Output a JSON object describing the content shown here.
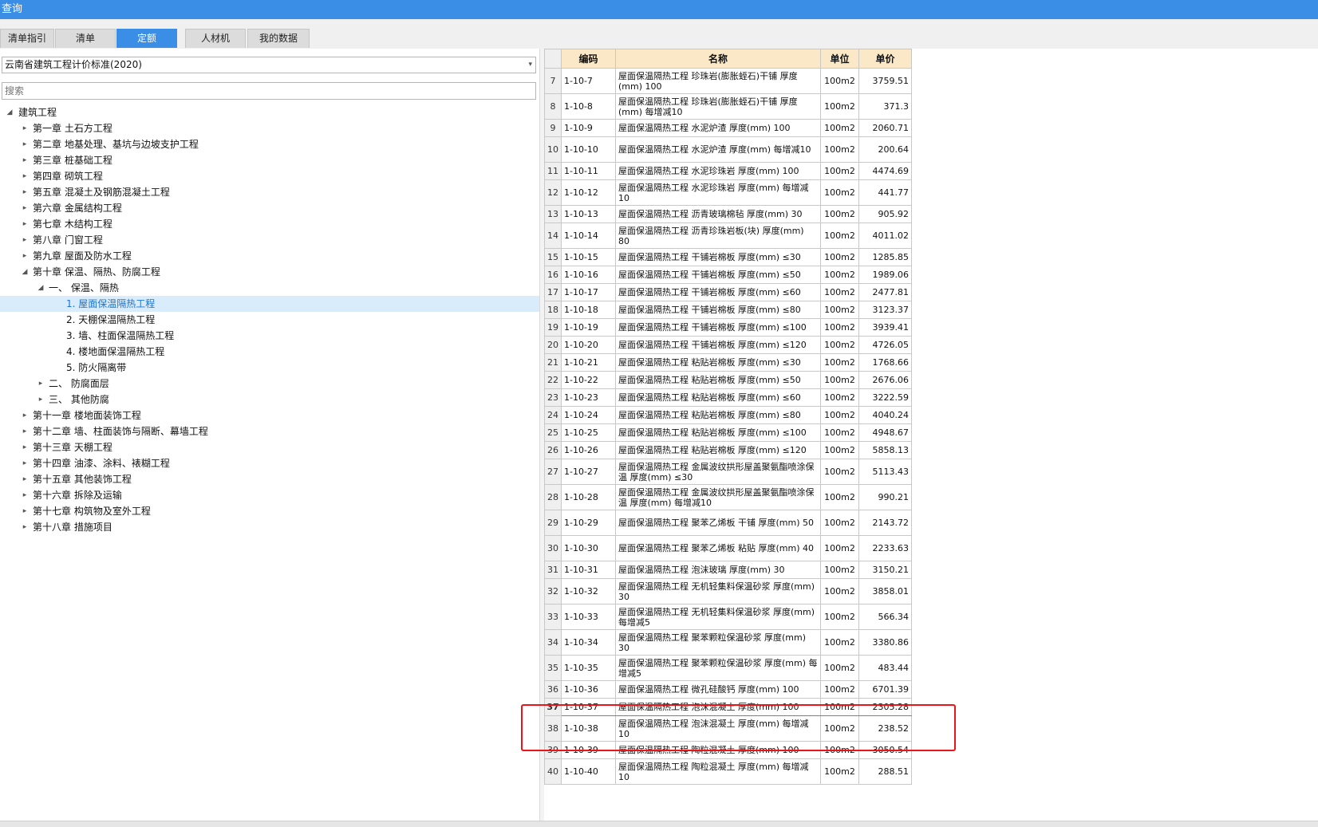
{
  "window": {
    "title": "查询"
  },
  "tabs": [
    {
      "label": "清单指引",
      "active": false
    },
    {
      "label": "清单",
      "active": false
    },
    {
      "label": "定额",
      "active": true
    },
    {
      "label": "人材机",
      "active": false
    },
    {
      "label": "我的数据",
      "active": false
    }
  ],
  "left": {
    "standard_select": {
      "value": "云南省建筑工程计价标准(2020)"
    },
    "search": {
      "placeholder": "搜索"
    },
    "tree": [
      {
        "label": "建筑工程",
        "level": 0,
        "toggle": "expanded"
      },
      {
        "label": "第一章 土石方工程",
        "level": 1,
        "toggle": "collapsed"
      },
      {
        "label": "第二章 地基处理、基坑与边坡支护工程",
        "level": 1,
        "toggle": "collapsed"
      },
      {
        "label": "第三章 桩基础工程",
        "level": 1,
        "toggle": "collapsed"
      },
      {
        "label": "第四章 砌筑工程",
        "level": 1,
        "toggle": "collapsed"
      },
      {
        "label": "第五章 混凝土及钢筋混凝土工程",
        "level": 1,
        "toggle": "collapsed"
      },
      {
        "label": "第六章 金属结构工程",
        "level": 1,
        "toggle": "collapsed"
      },
      {
        "label": "第七章 木结构工程",
        "level": 1,
        "toggle": "collapsed"
      },
      {
        "label": "第八章 门窗工程",
        "level": 1,
        "toggle": "collapsed"
      },
      {
        "label": "第九章 屋面及防水工程",
        "level": 1,
        "toggle": "collapsed"
      },
      {
        "label": "第十章 保温、隔热、防腐工程",
        "level": 1,
        "toggle": "expanded"
      },
      {
        "label": "一、 保温、隔热",
        "level": 2,
        "toggle": "expanded"
      },
      {
        "label": "1. 屋面保温隔热工程",
        "level": 3,
        "toggle": "none",
        "selected": true
      },
      {
        "label": "2. 天棚保温隔热工程",
        "level": 3,
        "toggle": "none"
      },
      {
        "label": "3. 墙、柱面保温隔热工程",
        "level": 3,
        "toggle": "none"
      },
      {
        "label": "4. 楼地面保温隔热工程",
        "level": 3,
        "toggle": "none"
      },
      {
        "label": "5. 防火隔离带",
        "level": 3,
        "toggle": "none"
      },
      {
        "label": "二、 防腐面层",
        "level": 2,
        "toggle": "collapsed"
      },
      {
        "label": "三、 其他防腐",
        "level": 2,
        "toggle": "collapsed"
      },
      {
        "label": "第十一章 楼地面装饰工程",
        "level": 1,
        "toggle": "collapsed"
      },
      {
        "label": "第十二章 墙、柱面装饰与隔断、幕墙工程",
        "level": 1,
        "toggle": "collapsed"
      },
      {
        "label": "第十三章 天棚工程",
        "level": 1,
        "toggle": "collapsed"
      },
      {
        "label": "第十四章 油漆、涂料、裱糊工程",
        "level": 1,
        "toggle": "collapsed"
      },
      {
        "label": "第十五章 其他装饰工程",
        "level": 1,
        "toggle": "collapsed"
      },
      {
        "label": "第十六章 拆除及运输",
        "level": 1,
        "toggle": "collapsed"
      },
      {
        "label": "第十七章 构筑物及室外工程",
        "level": 1,
        "toggle": "collapsed"
      },
      {
        "label": "第十八章 措施项目",
        "level": 1,
        "toggle": "collapsed"
      }
    ]
  },
  "grid": {
    "columns": [
      "编码",
      "名称",
      "单位",
      "单价"
    ],
    "rows": [
      {
        "no": "7",
        "code": "1-10-7",
        "name": "屋面保温隔热工程 珍珠岩(膨胀蛭石)干铺 厚度(mm) 100",
        "unit": "100m2",
        "price": "3759.51",
        "tall": true
      },
      {
        "no": "8",
        "code": "1-10-8",
        "name": "屋面保温隔热工程 珍珠岩(膨胀蛭石)干铺 厚度(mm) 每增减10",
        "unit": "100m2",
        "price": "371.3",
        "tall": true
      },
      {
        "no": "9",
        "code": "1-10-9",
        "name": "屋面保温隔热工程 水泥炉渣 厚度(mm) 100",
        "unit": "100m2",
        "price": "2060.71",
        "tall": false
      },
      {
        "no": "10",
        "code": "1-10-10",
        "name": "屋面保温隔热工程 水泥炉渣 厚度(mm) 每增减10",
        "unit": "100m2",
        "price": "200.64",
        "tall": true
      },
      {
        "no": "11",
        "code": "1-10-11",
        "name": "屋面保温隔热工程 水泥珍珠岩 厚度(mm) 100",
        "unit": "100m2",
        "price": "4474.69",
        "tall": false
      },
      {
        "no": "12",
        "code": "1-10-12",
        "name": "屋面保温隔热工程 水泥珍珠岩 厚度(mm) 每增减10",
        "unit": "100m2",
        "price": "441.77",
        "tall": true
      },
      {
        "no": "13",
        "code": "1-10-13",
        "name": "屋面保温隔热工程 沥青玻璃棉毡 厚度(mm) 30",
        "unit": "100m2",
        "price": "905.92",
        "tall": false
      },
      {
        "no": "14",
        "code": "1-10-14",
        "name": "屋面保温隔热工程 沥青珍珠岩板(块) 厚度(mm) 80",
        "unit": "100m2",
        "price": "4011.02",
        "tall": true
      },
      {
        "no": "15",
        "code": "1-10-15",
        "name": "屋面保温隔热工程 干铺岩棉板 厚度(mm) ≤30",
        "unit": "100m2",
        "price": "1285.85",
        "tall": false
      },
      {
        "no": "16",
        "code": "1-10-16",
        "name": "屋面保温隔热工程 干铺岩棉板 厚度(mm) ≤50",
        "unit": "100m2",
        "price": "1989.06",
        "tall": false
      },
      {
        "no": "17",
        "code": "1-10-17",
        "name": "屋面保温隔热工程 干铺岩棉板 厚度(mm) ≤60",
        "unit": "100m2",
        "price": "2477.81",
        "tall": false
      },
      {
        "no": "18",
        "code": "1-10-18",
        "name": "屋面保温隔热工程 干铺岩棉板 厚度(mm) ≤80",
        "unit": "100m2",
        "price": "3123.37",
        "tall": false
      },
      {
        "no": "19",
        "code": "1-10-19",
        "name": "屋面保温隔热工程 干铺岩棉板 厚度(mm) ≤100",
        "unit": "100m2",
        "price": "3939.41",
        "tall": false
      },
      {
        "no": "20",
        "code": "1-10-20",
        "name": "屋面保温隔热工程 干铺岩棉板 厚度(mm) ≤120",
        "unit": "100m2",
        "price": "4726.05",
        "tall": false
      },
      {
        "no": "21",
        "code": "1-10-21",
        "name": "屋面保温隔热工程 粘贴岩棉板 厚度(mm) ≤30",
        "unit": "100m2",
        "price": "1768.66",
        "tall": false
      },
      {
        "no": "22",
        "code": "1-10-22",
        "name": "屋面保温隔热工程 粘贴岩棉板 厚度(mm) ≤50",
        "unit": "100m2",
        "price": "2676.06",
        "tall": false
      },
      {
        "no": "23",
        "code": "1-10-23",
        "name": "屋面保温隔热工程 粘贴岩棉板 厚度(mm) ≤60",
        "unit": "100m2",
        "price": "3222.59",
        "tall": false
      },
      {
        "no": "24",
        "code": "1-10-24",
        "name": "屋面保温隔热工程 粘贴岩棉板 厚度(mm) ≤80",
        "unit": "100m2",
        "price": "4040.24",
        "tall": false
      },
      {
        "no": "25",
        "code": "1-10-25",
        "name": "屋面保温隔热工程 粘贴岩棉板 厚度(mm) ≤100",
        "unit": "100m2",
        "price": "4948.67",
        "tall": false
      },
      {
        "no": "26",
        "code": "1-10-26",
        "name": "屋面保温隔热工程 粘贴岩棉板 厚度(mm) ≤120",
        "unit": "100m2",
        "price": "5858.13",
        "tall": false
      },
      {
        "no": "27",
        "code": "1-10-27",
        "name": "屋面保温隔热工程 金属波纹拱形屋盖聚氨酯喷涂保温 厚度(mm) ≤30",
        "unit": "100m2",
        "price": "5113.43",
        "tall": true
      },
      {
        "no": "28",
        "code": "1-10-28",
        "name": "屋面保温隔热工程 金属波纹拱形屋盖聚氨酯喷涂保温 厚度(mm) 每增减10",
        "unit": "100m2",
        "price": "990.21",
        "tall": true
      },
      {
        "no": "29",
        "code": "1-10-29",
        "name": "屋面保温隔热工程 聚苯乙烯板 干铺 厚度(mm) 50",
        "unit": "100m2",
        "price": "2143.72",
        "tall": true
      },
      {
        "no": "30",
        "code": "1-10-30",
        "name": "屋面保温隔热工程 聚苯乙烯板 粘贴 厚度(mm) 40",
        "unit": "100m2",
        "price": "2233.63",
        "tall": true
      },
      {
        "no": "31",
        "code": "1-10-31",
        "name": "屋面保温隔热工程 泡沫玻璃 厚度(mm) 30",
        "unit": "100m2",
        "price": "3150.21",
        "tall": false
      },
      {
        "no": "32",
        "code": "1-10-32",
        "name": "屋面保温隔热工程 无机轻集料保温砂浆 厚度(mm) 30",
        "unit": "100m2",
        "price": "3858.01",
        "tall": true
      },
      {
        "no": "33",
        "code": "1-10-33",
        "name": "屋面保温隔热工程 无机轻集料保温砂浆 厚度(mm) 每增减5",
        "unit": "100m2",
        "price": "566.34",
        "tall": true
      },
      {
        "no": "34",
        "code": "1-10-34",
        "name": "屋面保温隔热工程 聚苯颗粒保温砂浆 厚度(mm) 30",
        "unit": "100m2",
        "price": "3380.86",
        "tall": true
      },
      {
        "no": "35",
        "code": "1-10-35",
        "name": "屋面保温隔热工程 聚苯颗粒保温砂浆 厚度(mm) 每增减5",
        "unit": "100m2",
        "price": "483.44",
        "tall": true
      },
      {
        "no": "36",
        "code": "1-10-36",
        "name": "屋面保温隔热工程 微孔硅酸钙 厚度(mm) 100",
        "unit": "100m2",
        "price": "6701.39",
        "tall": false
      },
      {
        "no": "37",
        "code": "1-10-37",
        "name": "屋面保温隔热工程 泡沫混凝土 厚度(mm) 100",
        "unit": "100m2",
        "price": "2305.28",
        "tall": false,
        "current": true
      },
      {
        "no": "38",
        "code": "1-10-38",
        "name": "屋面保温隔热工程 泡沫混凝土 厚度(mm) 每增减10",
        "unit": "100m2",
        "price": "238.52",
        "tall": true
      },
      {
        "no": "39",
        "code": "1-10-39",
        "name": "屋面保温隔热工程 陶粒混凝土 厚度(mm) 100",
        "unit": "100m2",
        "price": "3050.54",
        "tall": false
      },
      {
        "no": "40",
        "code": "1-10-40",
        "name": "屋面保温隔热工程 陶粒混凝土 厚度(mm) 每增减10",
        "unit": "100m2",
        "price": "288.51",
        "tall": true
      }
    ]
  },
  "colors": {
    "accent": "#3a8ee6",
    "header_bg": "#fbe8c6",
    "highlight_border": "#e8161a",
    "selected_bg": "#d9ecfb"
  }
}
